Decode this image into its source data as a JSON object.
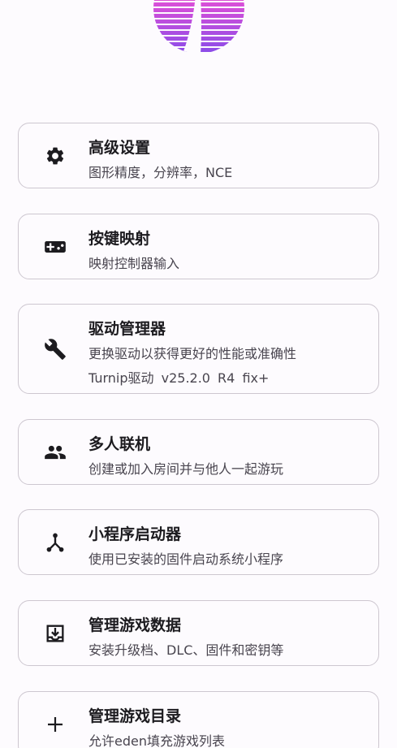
{
  "menu": [
    {
      "title": "高级设置",
      "desc": "图形精度，分辨率，NCE",
      "icon": "gear-icon"
    },
    {
      "title": "按键映射",
      "desc": "映射控制器输入",
      "icon": "gamepad-icon"
    },
    {
      "title": "驱动管理器",
      "desc": "更换驱动以获得更好的性能或准确性",
      "desc2": "Turnip驱动 v25.2.0 R4 fix+",
      "icon": "wrench-icon"
    },
    {
      "title": "多人联机",
      "desc": "创建或加入房间并与他人一起游玩",
      "icon": "people-icon"
    },
    {
      "title": "小程序启动器",
      "desc": "使用已安装的固件启动系统小程序",
      "icon": "applet-tree-icon"
    },
    {
      "title": "管理游戏数据",
      "desc": "安装升级档、DLC、固件和密钥等",
      "icon": "install-tray-icon"
    },
    {
      "title": "管理游戏目录",
      "desc": "允许eden填充游戏列表",
      "icon": "plus-icon"
    }
  ],
  "colors": {
    "accent_pink": "#ff5fa2",
    "accent_purple": "#8a4ce8",
    "text_primary": "#1c1b1f",
    "text_secondary": "#49454f",
    "card_border": "#cdc7d0",
    "background": "#fdfbfe"
  }
}
